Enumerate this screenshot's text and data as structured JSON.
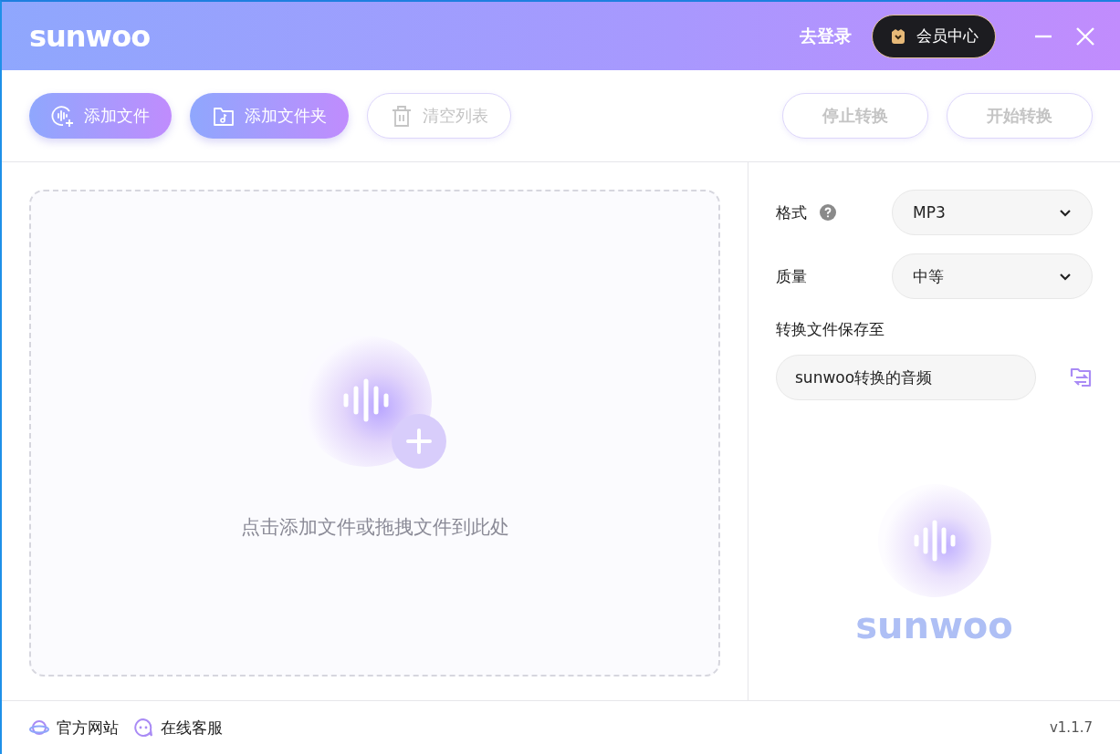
{
  "header": {
    "logo": "sunwoo",
    "login": "去登录",
    "vip": "会员中心"
  },
  "toolbar": {
    "left": [
      {
        "label": "添加文件",
        "kind": "add-file",
        "disabled": false
      },
      {
        "label": "添加文件夹",
        "kind": "add-folder",
        "disabled": false
      },
      {
        "label": "清空列表",
        "kind": "clear",
        "disabled": true
      }
    ],
    "right": [
      {
        "label": "停止转换",
        "disabled": true
      },
      {
        "label": "开始转换",
        "disabled": true
      }
    ]
  },
  "drop_zone": {
    "hint": "点击添加文件或拖拽文件到此处"
  },
  "settings": {
    "format": {
      "label": "格式",
      "value": "MP3"
    },
    "quality": {
      "label": "质量",
      "value": "中等"
    },
    "save_to": {
      "label": "转换文件保存至",
      "value": "sunwoo转换的音频"
    }
  },
  "brand": {
    "logo": "sunwoo"
  },
  "footer": {
    "links": [
      {
        "label": "官方网站",
        "kind": "globe"
      },
      {
        "label": "在线客服",
        "kind": "chat"
      }
    ],
    "version": "v1.1.7"
  }
}
